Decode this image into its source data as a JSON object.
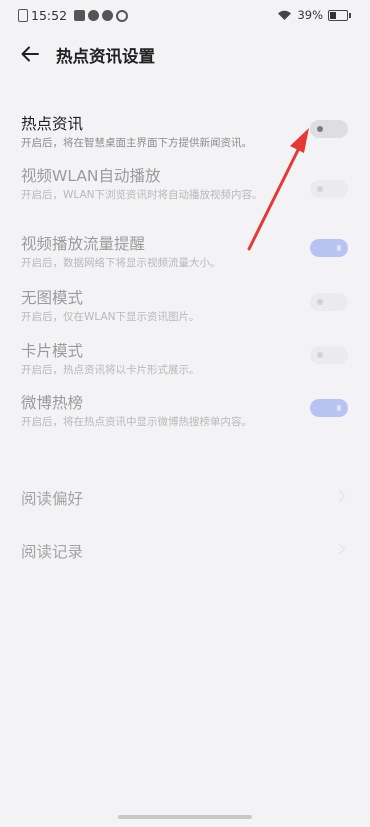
{
  "status_bar": {
    "time": "15:52",
    "battery": "39%"
  },
  "header": {
    "title": "热点资讯设置"
  },
  "settings": [
    {
      "title": "热点资讯",
      "desc": "开启后，将在智慧桌面主界面下方提供新闻资讯。",
      "state": "off"
    },
    {
      "title": "视频WLAN自动播放",
      "desc": "开启后，WLAN下浏览资讯时将自动播放视频内容。",
      "state": "off"
    },
    {
      "title": "视频播放流量提醒",
      "desc": "开启后，数据网络下将显示视频流量大小。",
      "state": "on"
    },
    {
      "title": "无图模式",
      "desc": "开启后，仅在WLAN下显示资讯图片。",
      "state": "off"
    },
    {
      "title": "卡片模式",
      "desc": "开启后，热点资讯将以卡片形式展示。",
      "state": "off"
    },
    {
      "title": "微博热榜",
      "desc": "开启后，将在热点资讯中显示微博热搜榜单内容。",
      "state": "on"
    }
  ],
  "nav_items": [
    {
      "label": "阅读偏好"
    },
    {
      "label": "阅读记录"
    }
  ],
  "colors": {
    "background": "#f3f3f5",
    "toggle_on": "#b7c4f2",
    "toggle_off": "#e2e2e4",
    "annotation_arrow": "#e53935"
  },
  "icons": [
    "back-arrow-icon",
    "wifi-icon",
    "battery-icon",
    "chevron-right-icon"
  ]
}
